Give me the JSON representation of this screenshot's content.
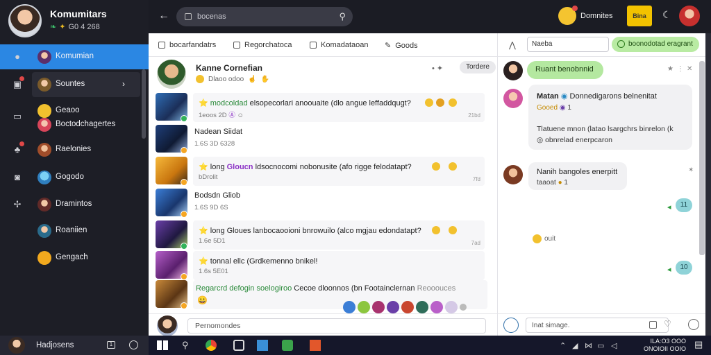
{
  "profile": {
    "name": "Komumitars",
    "subtitle": "G0 4 268"
  },
  "sidebar": {
    "items": [
      {
        "label": "Komumian",
        "active": true
      },
      {
        "label": "Sountes"
      },
      {
        "label": "Geaoo"
      },
      {
        "label": "Boctodchagertes"
      },
      {
        "label": "Raelonies"
      },
      {
        "label": "Gogodo"
      },
      {
        "label": "Dramintos"
      },
      {
        "label": "Roaniien"
      },
      {
        "label": "Gengach"
      }
    ],
    "bottom_user": "Hadjosens"
  },
  "topbar": {
    "search_placeholder": "bocenas",
    "label": "Domnites",
    "badge": "Bina"
  },
  "feed": {
    "tabs": [
      "bocarfandatrs",
      "Regorchatoca",
      "Komadataoan",
      "Goods"
    ],
    "post": {
      "title": "Kanne Cornefian",
      "meta": "Dlaoo odoo",
      "pill": "Tordere"
    },
    "items": [
      {
        "highlight": "modcoldad",
        "text": "elsopecorlari anoouaite (dlo angue leffaddqugt?",
        "meta": "1eoos 2D",
        "time": "21bd"
      },
      {
        "title": "Nadean Siidat",
        "meta": "1.6S 3D 6328"
      },
      {
        "highlight": "Gloucn",
        "prefix": "long",
        "text": "ldsocnocomi nobonusite (afo rigge felodatapt?",
        "meta": "bDrolit",
        "time": "7fd"
      },
      {
        "title": "Bodsdn Gliob",
        "meta": "1.6S 9D 6S"
      },
      {
        "prefix": "long",
        "text": "Gloues lanbocaooioni bnrowuilo (alco mgjau edondatapt?",
        "meta": "1.6e 5D1",
        "time": "7ad"
      },
      {
        "prefix": "tonnal",
        "text": "ellc (Grdkemenno bnikel!",
        "meta": "1.6s 5E01",
        "time": ""
      }
    ],
    "last": {
      "highlight": "Regarcrd defogin soelogiroo",
      "text": "Cecoe dloonnos (bn Footainclernan",
      "muted": "Reooouces"
    },
    "composer_placeholder": "Pernomondes"
  },
  "chat": {
    "field": "Naeba",
    "green_button": "boonodotad eragrant",
    "bubble_top": "Ruant benobnnid",
    "msg1": {
      "title": "Matan",
      "text": "Donnedigarons belnenitat",
      "sub": "Gooed",
      "count": "1",
      "body1": "Tlatuene mnon (latao lsargchrs binrelon (k",
      "body2": "obnrelad enerpcaron"
    },
    "msg2": {
      "title": "Nanih bangoles enerpitt",
      "sub": "taaoat",
      "count": "1"
    },
    "reply1": "11",
    "reply2": "10",
    "typing": "ouit",
    "compose_placeholder": "Inat simage."
  },
  "taskbar": {
    "clock_time": "ILA:O3 OOO",
    "clock_date": "ONOIOII OOIO"
  },
  "colors": {
    "accent": "#2b87e3",
    "sidebar": "#1d1e26",
    "green": "#b4e8a0"
  }
}
